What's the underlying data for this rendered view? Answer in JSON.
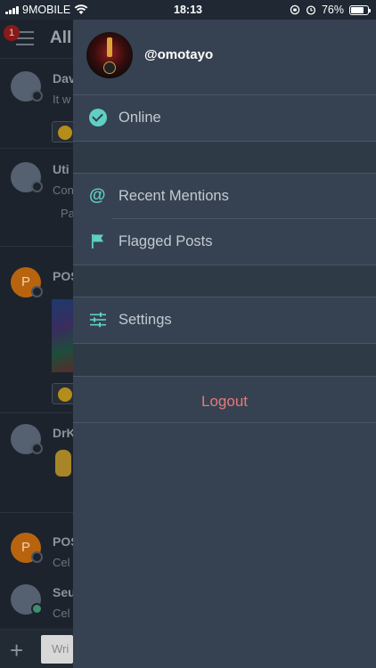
{
  "status_bar": {
    "carrier": "9MOBILE",
    "time": "18:13",
    "battery": "76%",
    "battery_level": 0.76
  },
  "channel": {
    "badge_count": "1",
    "title": "All",
    "posts": [
      {
        "name": "Dav",
        "text": "It w"
      },
      {
        "name": "Uti",
        "text": "Con",
        "extra": "Pa"
      },
      {
        "name": "POS",
        "initial": "P"
      },
      {
        "name": "DrK"
      },
      {
        "name": "POS",
        "initial": "P",
        "text": "Cel"
      },
      {
        "name": "Seu",
        "text": "Cel"
      }
    ],
    "composer_placeholder": "Wri"
  },
  "drawer": {
    "username": "@omotayo",
    "status_label": "Online",
    "menu": {
      "recent_mentions": "Recent Mentions",
      "flagged_posts": "Flagged Posts",
      "settings": "Settings"
    },
    "logout": "Logout"
  },
  "colors": {
    "drawer_bg": "#364251",
    "accent_teal": "#5fd0c3",
    "logout_red": "#e7787d",
    "badge_red": "#8a1a1a"
  }
}
